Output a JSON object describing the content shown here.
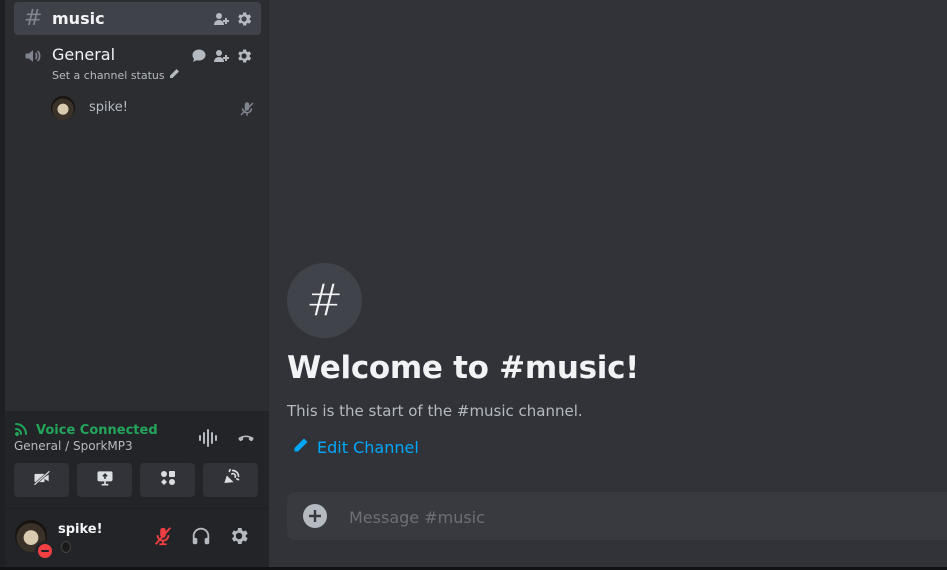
{
  "sidebar": {
    "channels": [
      {
        "symbol": "#",
        "name": "music",
        "active": true
      },
      {
        "name": "General",
        "status": "Set a channel status"
      }
    ],
    "voice_users": [
      {
        "name": "spike!"
      }
    ]
  },
  "voice_panel": {
    "status": "Voice Connected",
    "location": "General / SporkMP3"
  },
  "user_panel": {
    "username": "spike!"
  },
  "main": {
    "welcome_icon": "#",
    "welcome_title": "Welcome to #music!",
    "welcome_sub": "This is the start of the #music channel.",
    "edit_channel": "Edit Channel",
    "composer_placeholder": "Message #music"
  },
  "colors": {
    "accent_link": "#00a8fc",
    "voice_green": "#23a55a",
    "dnd_red": "#f23f43"
  }
}
